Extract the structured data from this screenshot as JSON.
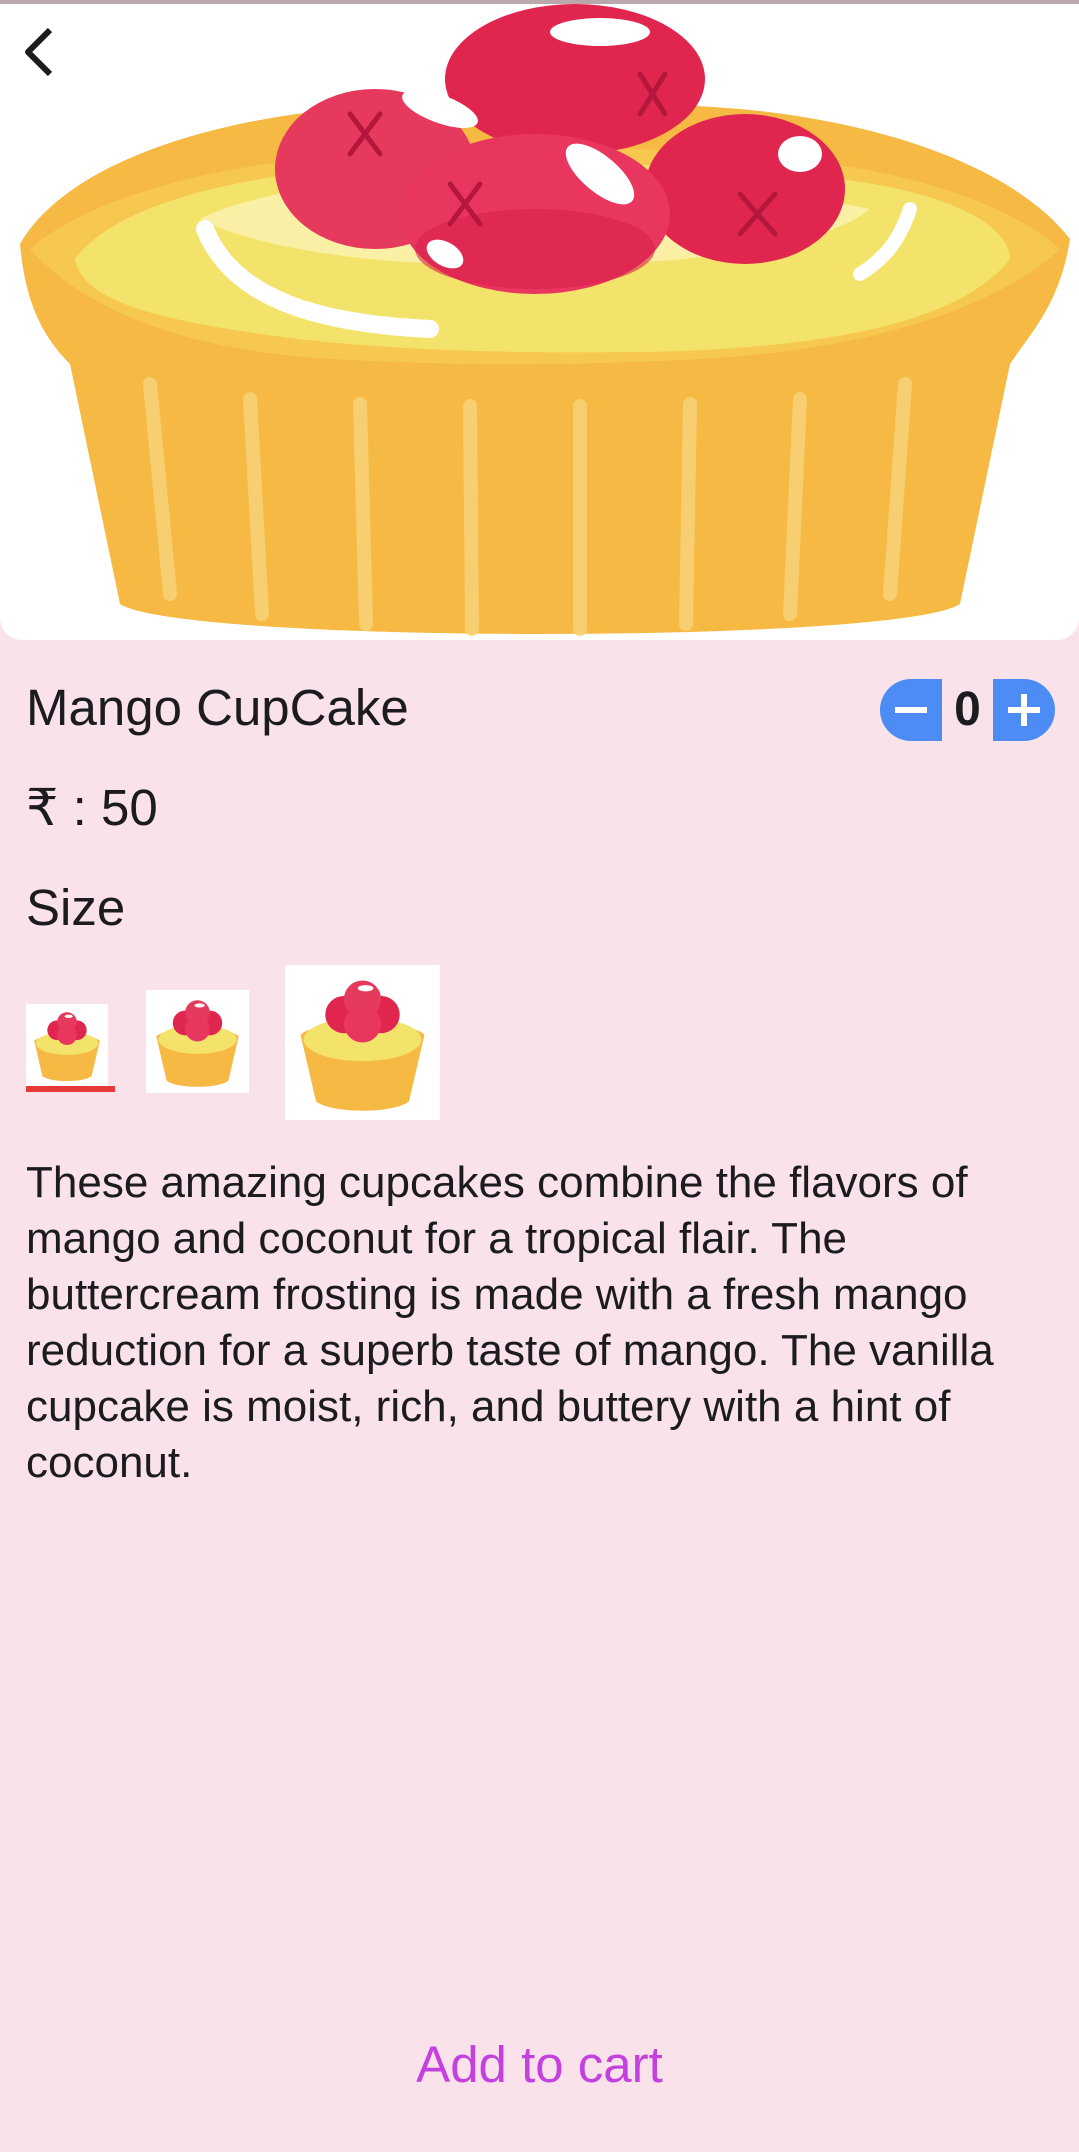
{
  "product": {
    "name": "Mango CupCake",
    "price_text": "₹ : 50",
    "description": "These amazing cupcakes combine the flavors of mango and coconut for a tropical flair. The buttercream frosting is made with a fresh mango reduction for a superb taste of mango. The vanilla cupcake is moist, rich, and buttery with a hint of coconut."
  },
  "quantity": {
    "value": "0",
    "decrement_symbol": "−",
    "increment_symbol": "+"
  },
  "size": {
    "label": "Size",
    "options": [
      "small",
      "medium",
      "large"
    ],
    "selected": "small"
  },
  "actions": {
    "add_to_cart_label": "Add to cart"
  },
  "icons": {
    "back": "chevron-left-icon",
    "minus": "minus-icon",
    "plus": "plus-icon"
  },
  "colors": {
    "background": "#f9e2ea",
    "quantity_button": "#4d8cf5",
    "add_to_cart_text": "#c441e0",
    "selected_size_underline": "#e53935"
  }
}
